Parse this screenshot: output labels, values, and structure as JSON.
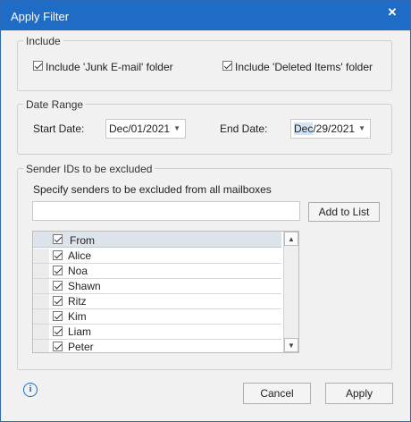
{
  "window": {
    "title": "Apply Filter",
    "close_glyph": "✕"
  },
  "include": {
    "label": "Include",
    "junk": {
      "label": "Include 'Junk E-mail' folder",
      "checked": true
    },
    "deleted": {
      "label": "Include 'Deleted Items' folder",
      "checked": true
    }
  },
  "date_range": {
    "label": "Date Range",
    "start_label": "Start Date:",
    "start_value": "Dec/01/2021",
    "end_label": "End Date:",
    "end_value_hl": "Dec",
    "end_value_rest": "/29/2021"
  },
  "senders": {
    "label": "Sender IDs to be excluded",
    "hint": "Specify senders to be excluded from all mailboxes",
    "input_value": "",
    "add_button": "Add to List",
    "list_header": "From",
    "rows": [
      "Alice",
      "Noa",
      "Shawn",
      "Ritz",
      "Kim",
      "Liam",
      "Peter"
    ]
  },
  "footer": {
    "cancel": "Cancel",
    "apply": "Apply",
    "info_glyph": "i"
  },
  "colors": {
    "accent": "#1e6cc6",
    "dialog_bg": "#f1f1f1"
  }
}
